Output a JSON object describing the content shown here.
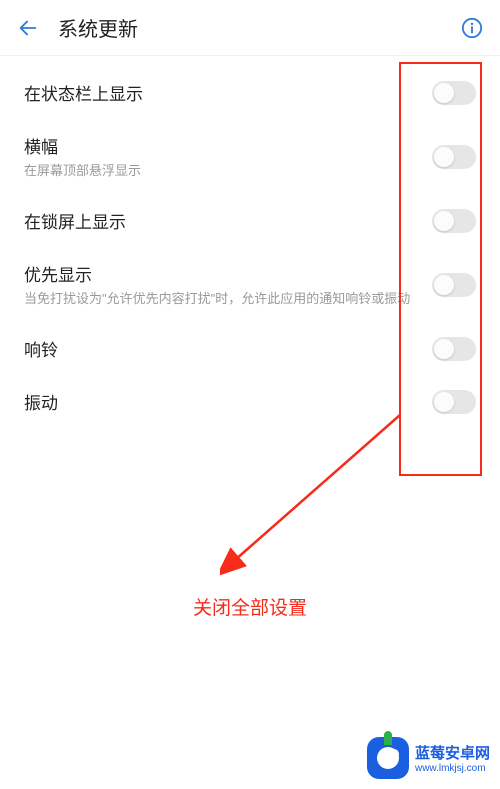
{
  "header": {
    "title": "系统更新"
  },
  "rows": {
    "status_bar": {
      "title": "在状态栏上显示"
    },
    "banner": {
      "title": "横幅",
      "sub": "在屏幕顶部悬浮显示"
    },
    "lockscreen": {
      "title": "在锁屏上显示"
    },
    "priority": {
      "title": "优先显示",
      "sub": "当免打扰设为\"允许优先内容打扰\"时，允许此应用的通知响铃或振动"
    },
    "ring": {
      "title": "响铃"
    },
    "vibrate": {
      "title": "振动"
    }
  },
  "annotation": {
    "label": "关闭全部设置"
  },
  "watermark": {
    "line1": "蓝莓安卓网",
    "line2": "www.lmkjsj.com"
  }
}
